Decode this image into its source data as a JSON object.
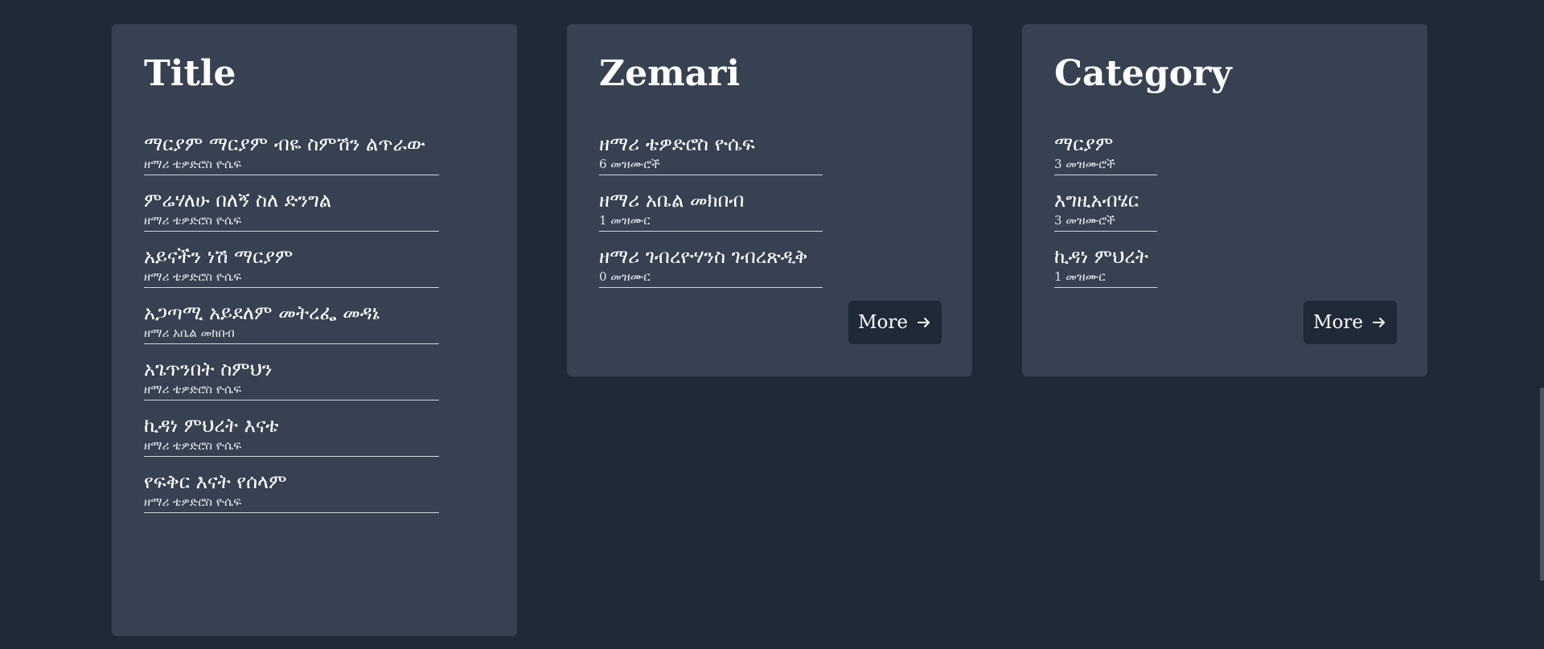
{
  "cards": {
    "title": {
      "heading": "Title",
      "items": [
        {
          "title": "ማርያም ማርያም ብዬ ስምሽን ልጥራው",
          "sub": "ዘማሪ ቴዎድሮስ ዮሴፍ"
        },
        {
          "title": "ምሬሃለሁ በለኝ ስለ ድንግል",
          "sub": "ዘማሪ ቴዎድሮስ ዮሴፍ"
        },
        {
          "title": "አይናችን ነሽ ማርያም",
          "sub": "ዘማሪ ቴዎድሮስ ዮሴፍ"
        },
        {
          "title": "አጋጣሚ አይደለም መትረፌ መዳኔ",
          "sub": "ዘማሪ አቤል መክበብ"
        },
        {
          "title": "አጌጥንበት ስምህን",
          "sub": "ዘማሪ ቴዎድሮስ ዮሴፍ"
        },
        {
          "title": "ኪዳነ ምህረት እናቴ",
          "sub": "ዘማሪ ቴዎድሮስ ዮሴፍ"
        },
        {
          "title": "የፍቅር እናት የሰላም",
          "sub": "ዘማሪ ቴዎድሮስ ዮሴፍ"
        }
      ]
    },
    "zemari": {
      "heading": "Zemari",
      "items": [
        {
          "title": "ዘማሪ ቴዎድሮስ ዮሴፍ",
          "sub": "6 መዝሙሮች"
        },
        {
          "title": "ዘማሪ አቤል መክበብ",
          "sub": "1 መዝሙር"
        },
        {
          "title": "ዘማሪ ገብረዮሃንስ ገብረጽዲቅ",
          "sub": "0 መዝሙር"
        }
      ],
      "more_label": "More",
      "more_icon": "arrow-right-icon"
    },
    "category": {
      "heading": "Category",
      "items": [
        {
          "title": "ማርያም",
          "sub": "3 መዝሙሮች"
        },
        {
          "title": "እግዚአብሄር",
          "sub": "3 መዝሙሮች"
        },
        {
          "title": "ኪዳነ ምህረት",
          "sub": "1 መዝሙር"
        }
      ],
      "more_label": "More",
      "more_icon": "arrow-right-icon"
    }
  },
  "colors": {
    "background": "#1f2937",
    "card": "#374151",
    "text": "#ffffff",
    "divider": "#d1d5db"
  }
}
